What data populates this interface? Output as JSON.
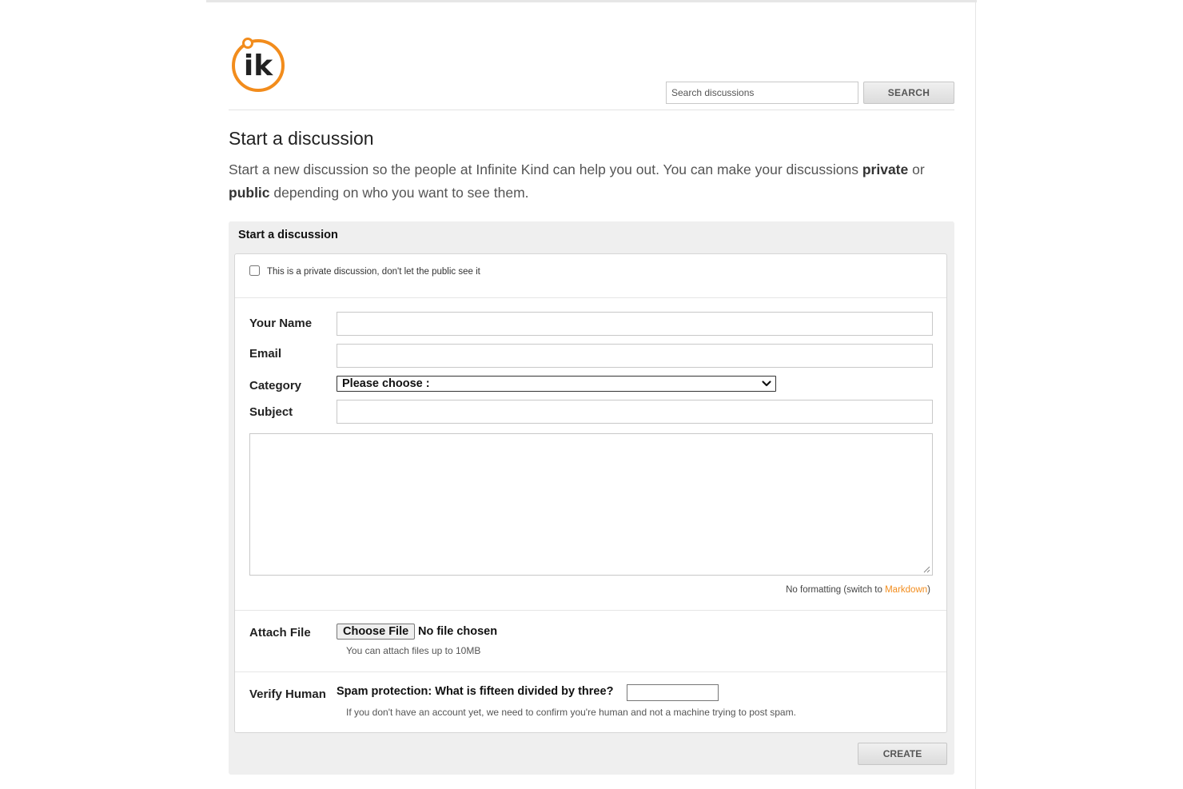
{
  "header": {
    "logo_text": "ik",
    "search_placeholder": "Search discussions",
    "search_button": "SEARCH"
  },
  "page": {
    "title": "Start a discussion",
    "intro_part1": "Start a new discussion so the people at Infinite Kind can help you out. You can make your discussions ",
    "intro_private": "private",
    "intro_or": " or ",
    "intro_public": "public",
    "intro_part2": " depending on who you want to see them."
  },
  "form": {
    "panel_title": "Start a discussion",
    "private_label": "This is a private discussion, don't let the public see it",
    "private_checked": false,
    "name_label": "Your Name",
    "name_value": "",
    "email_label": "Email",
    "email_value": "",
    "category_label": "Category",
    "category_selected": "Please choose :",
    "subject_label": "Subject",
    "subject_value": "",
    "body_value": "",
    "formatting_prefix": "No formatting (switch to ",
    "formatting_link": "Markdown",
    "formatting_suffix": ")",
    "attach_label": "Attach File",
    "choose_file_button": "Choose File",
    "file_status": "No file chosen",
    "attach_hint": "You can attach files up to 10MB",
    "verify_label": "Verify Human",
    "spam_question": "Spam protection: What is fifteen divided by three?",
    "spam_answer": "",
    "verify_hint": "If you don't have an account yet, we need to confirm you're human and not a machine trying to post spam.",
    "create_button": "CREATE"
  },
  "colors": {
    "accent": "#f28c1c",
    "panel_bg": "#efefef",
    "button_bg": "#e4e4e4"
  },
  "icons": {
    "logo": "ik-logo-icon",
    "select_caret": "chevron-down-icon",
    "resize": "resize-grip-icon"
  }
}
